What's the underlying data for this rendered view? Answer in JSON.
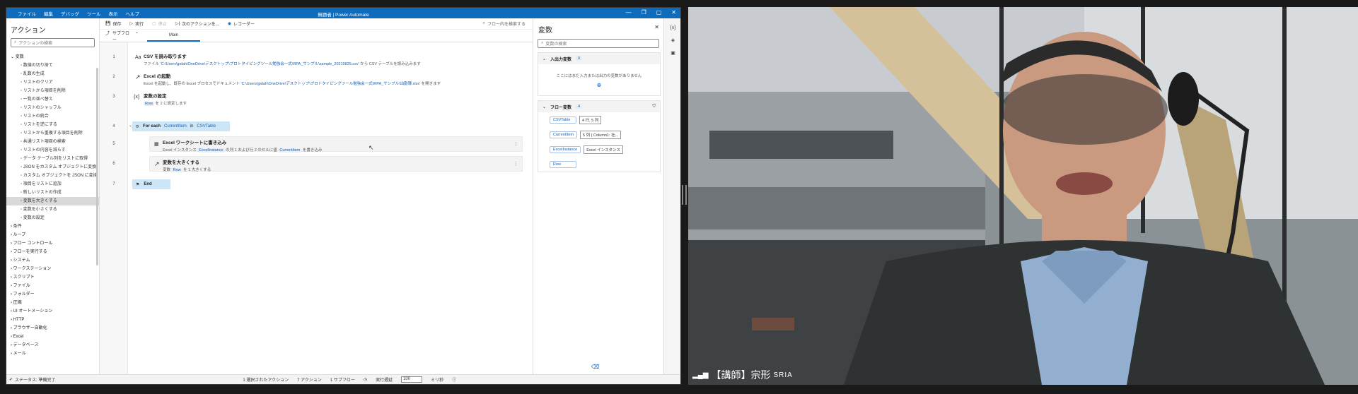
{
  "window": {
    "title": "無題者 | Power Automate",
    "menu": [
      "ファイル",
      "編集",
      "デバッグ",
      "ツール",
      "表示",
      "ヘルプ"
    ],
    "controls": [
      "—",
      "❐",
      "▢",
      "✕"
    ]
  },
  "actions_panel": {
    "title": "アクション",
    "search_placeholder": "アクションの検索",
    "category_open": "変数",
    "items": [
      "数値の切り捨て",
      "乱数の生成",
      "リストのクリア",
      "リストから項目を削除",
      "一覧の並べ替え",
      "リストのシャッフル",
      "リストの統合",
      "リストを逆にする",
      "リストから重複する項目を削除",
      "共通リスト項目の検索",
      "リストの内容を減らす",
      "データ テーブル列をリストに取得",
      "JSON をカスタム オブジェクトに変換",
      "カスタム オブジェクトを JSON に変換",
      "項目をリストに追加",
      "新しいリストの作成",
      "変数を大きくする",
      "変数を小さくする",
      "変数の設定"
    ],
    "selected_item": "変数を大きくする",
    "categories": [
      "条件",
      "ループ",
      "フロー コントロール",
      "フローを実行する",
      "システム",
      "ワークステーション",
      "スクリプト",
      "ファイル",
      "フォルダー",
      "圧縮",
      "UI オートメーション",
      "HTTP",
      "ブラウザー自動化",
      "Excel",
      "データベース",
      "メール"
    ]
  },
  "toolbar": {
    "save": "保存",
    "run": "実行",
    "stop": "停止",
    "next": "次のアクションを...",
    "recorder": "レコーダー",
    "flow_search": "フロー内を検索する"
  },
  "tabs": {
    "subflow": "サブフロー",
    "main": "Main"
  },
  "steps": [
    {
      "n": "1",
      "icon": "Aa",
      "title": "CSV を読み取ります",
      "desc_a": "ファイル",
      "desc_path": "'C:\\Users\\jpdah\\OneDrive\\デスクトップ\\プロトタイピングツール勉強会一式\\RPA_サンプル\\sample_20210825.csv'",
      "desc_b": "から CSV テーブルを読み込みます"
    },
    {
      "n": "2",
      "icon": "↗",
      "title": "Excel の起動",
      "desc_a": "Excel を起動し、既存の Excel プロセスでドキュメント",
      "desc_path": "'C:\\Users\\jpdah\\OneDrive\\デスクトップ\\プロトタイピングツール勉強会一式\\RPA_サンプル\\出勤簿.xlsx'",
      "desc_b": "を開きます"
    },
    {
      "n": "3",
      "icon": "{x}",
      "title": "変数の設定",
      "desc_var": "Row",
      "desc_b": "を 2 に設定します"
    },
    {
      "n": "4",
      "title": "For each",
      "var1": "CurrentItem",
      "in": "in",
      "var2": "CSVTable"
    },
    {
      "n": "5",
      "icon": "▦",
      "title": "Excel ワークシートに書き込み",
      "desc_a": "Excel インスタンス",
      "var1": "ExcelInstance",
      "desc_mid": "の列 1 および行 2 のセルに値",
      "var2": "CurrentItem",
      "desc_b": "を書き込み"
    },
    {
      "n": "6",
      "icon": "↗",
      "title": "変数を大きくする",
      "desc_a": "変数",
      "var1": "Row",
      "desc_b": "を 1 大きくする"
    },
    {
      "n": "7",
      "title": "End"
    }
  ],
  "variables_panel": {
    "title": "変数",
    "search_placeholder": "変数の検索",
    "io_title": "入出力変数",
    "io_count": "0",
    "io_empty": "ここにはまだ入力または出力の変数がありません",
    "flow_title": "フロー変数",
    "flow_count": "4",
    "flow_vars": [
      {
        "name": "CSVTable",
        "value": "4 行, 5 列"
      },
      {
        "name": "CurrentItem",
        "value": "5 列 { Column1: 社..."
      },
      {
        "name": "ExcelInstance",
        "value": "Excel インスタンス"
      },
      {
        "name": "Row",
        "value": ""
      }
    ]
  },
  "statusbar": {
    "status": "ステータス: 準備完了",
    "selected": "1 選択されたアクション",
    "actions": "7 アクション",
    "subflows": "1 サブフロー",
    "delay_label": "実行遅延",
    "delay_value": "100",
    "unit": "ミリ秒"
  },
  "video": {
    "caption": "【講師】宗形",
    "caption_tag": "SRIA"
  }
}
